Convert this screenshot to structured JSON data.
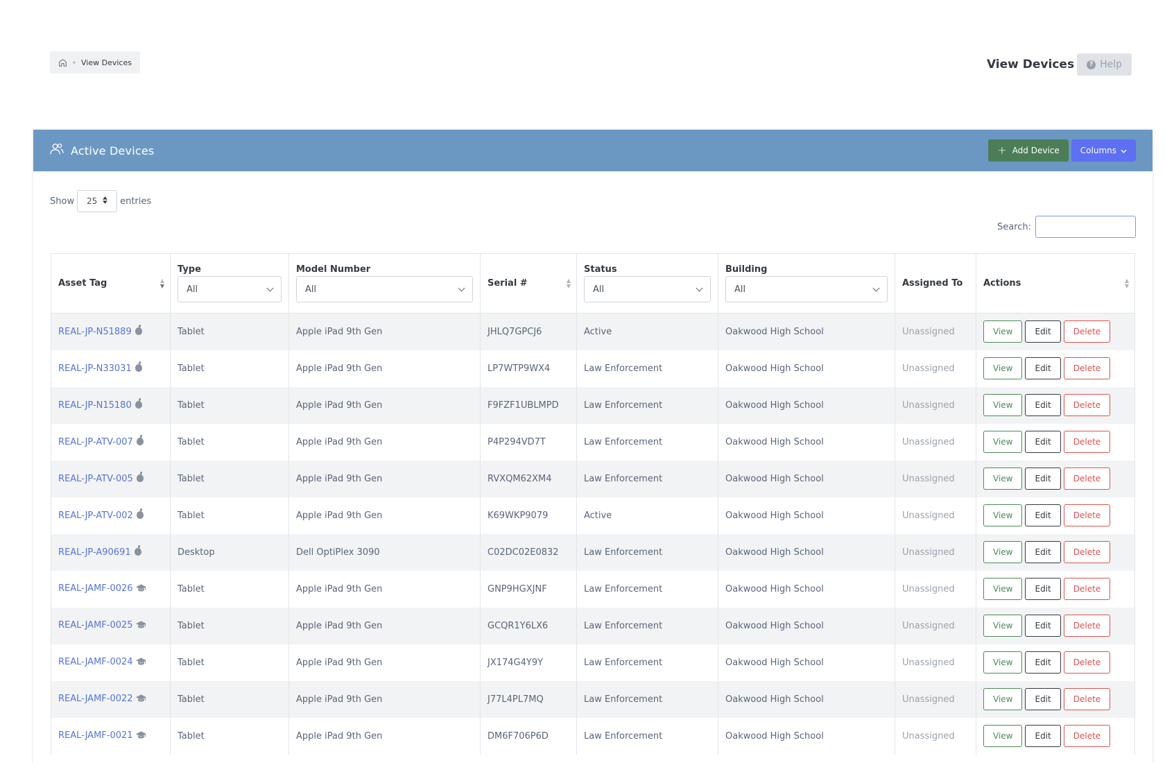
{
  "breadcrumb": {
    "current": "View Devices"
  },
  "header": {
    "title": "View Devices",
    "help_label": "Help"
  },
  "card": {
    "title": "Active Devices",
    "add_label": "Add Device",
    "columns_label": "Columns"
  },
  "controls": {
    "show_label": "Show",
    "entries_value": "25",
    "entries_label": "entries",
    "search_label": "Search:",
    "search_value": ""
  },
  "table": {
    "headers": {
      "asset_tag": "Asset Tag",
      "type": "Type",
      "model": "Model Number",
      "serial": "Serial #",
      "status": "Status",
      "building": "Building",
      "assigned": "Assigned To",
      "actions": "Actions"
    },
    "filters": {
      "type": "All",
      "model": "All",
      "status": "All",
      "building": "All"
    },
    "action_labels": {
      "view": "View",
      "edit": "Edit",
      "delete": "Delete"
    },
    "rows": [
      {
        "asset_tag": "REAL-JP-N51889",
        "icon": "apple-icon",
        "type": "Tablet",
        "model": "Apple iPad 9th Gen",
        "serial": "JHLQ7GPCJ6",
        "status": "Active",
        "building": "Oakwood High School",
        "assigned": "Unassigned"
      },
      {
        "asset_tag": "REAL-JP-N33031",
        "icon": "apple-icon",
        "type": "Tablet",
        "model": "Apple iPad 9th Gen",
        "serial": "LP7WTP9WX4",
        "status": "Law Enforcement",
        "building": "Oakwood High School",
        "assigned": "Unassigned"
      },
      {
        "asset_tag": "REAL-JP-N15180",
        "icon": "apple-icon",
        "type": "Tablet",
        "model": "Apple iPad 9th Gen",
        "serial": "F9FZF1UBLMPD",
        "status": "Law Enforcement",
        "building": "Oakwood High School",
        "assigned": "Unassigned"
      },
      {
        "asset_tag": "REAL-JP-ATV-007",
        "icon": "apple-icon",
        "type": "Tablet",
        "model": "Apple iPad 9th Gen",
        "serial": "P4P294VD7T",
        "status": "Law Enforcement",
        "building": "Oakwood High School",
        "assigned": "Unassigned"
      },
      {
        "asset_tag": "REAL-JP-ATV-005",
        "icon": "apple-icon",
        "type": "Tablet",
        "model": "Apple iPad 9th Gen",
        "serial": "RVXQM62XM4",
        "status": "Law Enforcement",
        "building": "Oakwood High School",
        "assigned": "Unassigned"
      },
      {
        "asset_tag": "REAL-JP-ATV-002",
        "icon": "apple-icon",
        "type": "Tablet",
        "model": "Apple iPad 9th Gen",
        "serial": "K69WKP9079",
        "status": "Active",
        "building": "Oakwood High School",
        "assigned": "Unassigned"
      },
      {
        "asset_tag": "REAL-JP-A90691",
        "icon": "apple-icon",
        "type": "Desktop",
        "model": "Dell OptiPlex 3090",
        "serial": "C02DC02E0832",
        "status": "Law Enforcement",
        "building": "Oakwood High School",
        "assigned": "Unassigned"
      },
      {
        "asset_tag": "REAL-JAMF-0026",
        "icon": "graduation-cap-icon",
        "type": "Tablet",
        "model": "Apple iPad 9th Gen",
        "serial": "GNP9HGXJNF",
        "status": "Law Enforcement",
        "building": "Oakwood High School",
        "assigned": "Unassigned"
      },
      {
        "asset_tag": "REAL-JAMF-0025",
        "icon": "graduation-cap-icon",
        "type": "Tablet",
        "model": "Apple iPad 9th Gen",
        "serial": "GCQR1Y6LX6",
        "status": "Law Enforcement",
        "building": "Oakwood High School",
        "assigned": "Unassigned"
      },
      {
        "asset_tag": "REAL-JAMF-0024",
        "icon": "graduation-cap-icon",
        "type": "Tablet",
        "model": "Apple iPad 9th Gen",
        "serial": "JX174G4Y9Y",
        "status": "Law Enforcement",
        "building": "Oakwood High School",
        "assigned": "Unassigned"
      },
      {
        "asset_tag": "REAL-JAMF-0022",
        "icon": "graduation-cap-icon",
        "type": "Tablet",
        "model": "Apple iPad 9th Gen",
        "serial": "J77L4PL7MQ",
        "status": "Law Enforcement",
        "building": "Oakwood High School",
        "assigned": "Unassigned"
      },
      {
        "asset_tag": "REAL-JAMF-0021",
        "icon": "graduation-cap-icon",
        "type": "Tablet",
        "model": "Apple iPad 9th Gen",
        "serial": "DM6F706P6D",
        "status": "Law Enforcement",
        "building": "Oakwood High School",
        "assigned": "Unassigned"
      }
    ]
  },
  "colors": {
    "card_header": "#6b98c2",
    "add_button": "#4b7d56",
    "columns_button": "#5d6ff2",
    "link": "#5673d6",
    "view": "#4b8a56",
    "delete": "#d9534f"
  }
}
